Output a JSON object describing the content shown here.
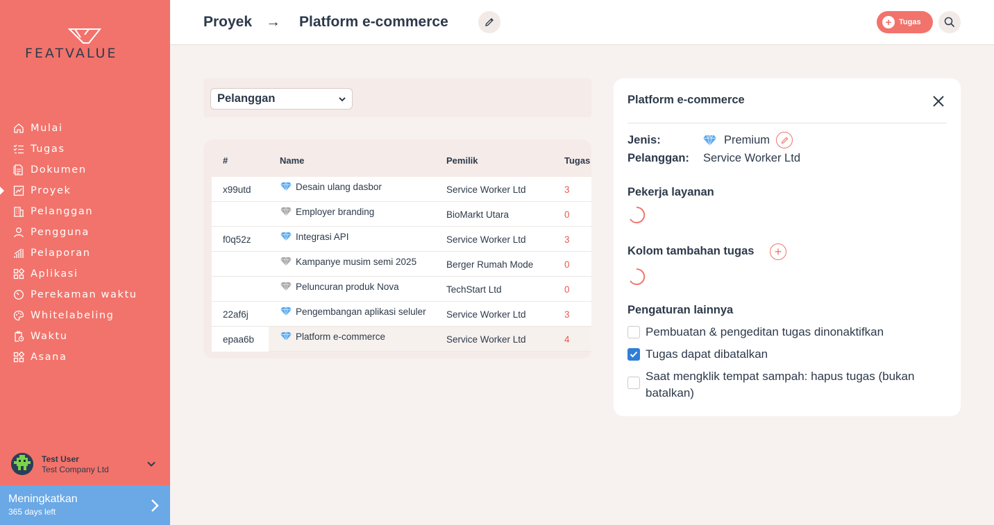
{
  "brand": {
    "name": "FEATVALUE"
  },
  "sidebar": {
    "items": [
      {
        "label": "Mulai",
        "icon": "home-icon"
      },
      {
        "label": "Tugas",
        "icon": "checklist-icon"
      },
      {
        "label": "Dokumen",
        "icon": "document-icon"
      },
      {
        "label": "Proyek",
        "icon": "chart-icon",
        "active": true
      },
      {
        "label": "Pelanggan",
        "icon": "building-icon"
      },
      {
        "label": "Pengguna",
        "icon": "user-icon"
      },
      {
        "label": "Pelaporan",
        "icon": "bar-chart-icon"
      },
      {
        "label": "Aplikasi",
        "icon": "apps-icon"
      },
      {
        "label": "Perekaman waktu",
        "icon": "timer-icon"
      },
      {
        "label": "Whitelabeling",
        "icon": "palette-icon"
      },
      {
        "label": "Waktu",
        "icon": "clipboard-clock-icon"
      },
      {
        "label": "Asana",
        "icon": "apps-icon"
      }
    ],
    "user": {
      "name": "Test User",
      "company": "Test Company Ltd"
    },
    "upgrade": {
      "title": "Meningkatkan",
      "subtitle": "365 days left"
    }
  },
  "header": {
    "breadcrumb_root": "Proyek",
    "breadcrumb_arrow": "→",
    "breadcrumb_current": "Platform e-commerce",
    "task_button": "Tugas"
  },
  "filter": {
    "selected": "Pelanggan"
  },
  "table": {
    "columns": [
      "#",
      "Name",
      "Pemilik",
      "Tugas"
    ],
    "rows": [
      {
        "id": "x99utd",
        "name": "Desain ulang dasbor",
        "owner": "Service Worker Ltd",
        "tasks": "3",
        "tier": "premium"
      },
      {
        "id": "",
        "name": "Employer branding",
        "owner": "BioMarkt Utara",
        "tasks": "0",
        "tier": "standard"
      },
      {
        "id": "f0q52z",
        "name": "Integrasi API",
        "owner": "Service Worker Ltd",
        "tasks": "3",
        "tier": "premium"
      },
      {
        "id": "",
        "name": "Kampanye musim semi 2025",
        "owner": "Berger Rumah Mode",
        "tasks": "0",
        "tier": "standard"
      },
      {
        "id": "",
        "name": "Peluncuran produk Nova",
        "owner": "TechStart Ltd",
        "tasks": "0",
        "tier": "standard"
      },
      {
        "id": "22af6j",
        "name": "Pengembangan aplikasi seluler",
        "owner": "Service Worker Ltd",
        "tasks": "3",
        "tier": "premium"
      },
      {
        "id": "epaa6b",
        "name": "Platform e-commerce",
        "owner": "Service Worker Ltd",
        "tasks": "4",
        "tier": "premium",
        "selected": true
      }
    ]
  },
  "panel": {
    "title": "Platform e-commerce",
    "type_label": "Jenis:",
    "type_value": "Premium",
    "customer_label": "Pelanggan:",
    "customer_value": "Service Worker Ltd",
    "section_workers": "Pekerja layanan",
    "section_columns": "Kolom tambahan tugas",
    "section_other": "Pengaturan lainnya",
    "checkboxes": [
      {
        "label": "Pembuatan & pengeditan tugas dinonaktifkan",
        "checked": false
      },
      {
        "label": "Tugas dapat dibatalkan",
        "checked": true
      },
      {
        "label": "Saat mengklik tempat sampah: hapus tugas (bukan batalkan)",
        "checked": false
      }
    ]
  },
  "colors": {
    "sidebar": "#f2736b",
    "accent": "#f2736b",
    "text": "#2d3a4a",
    "upgrade": "#6aa8e6",
    "checkbox": "#2f7ed8"
  }
}
